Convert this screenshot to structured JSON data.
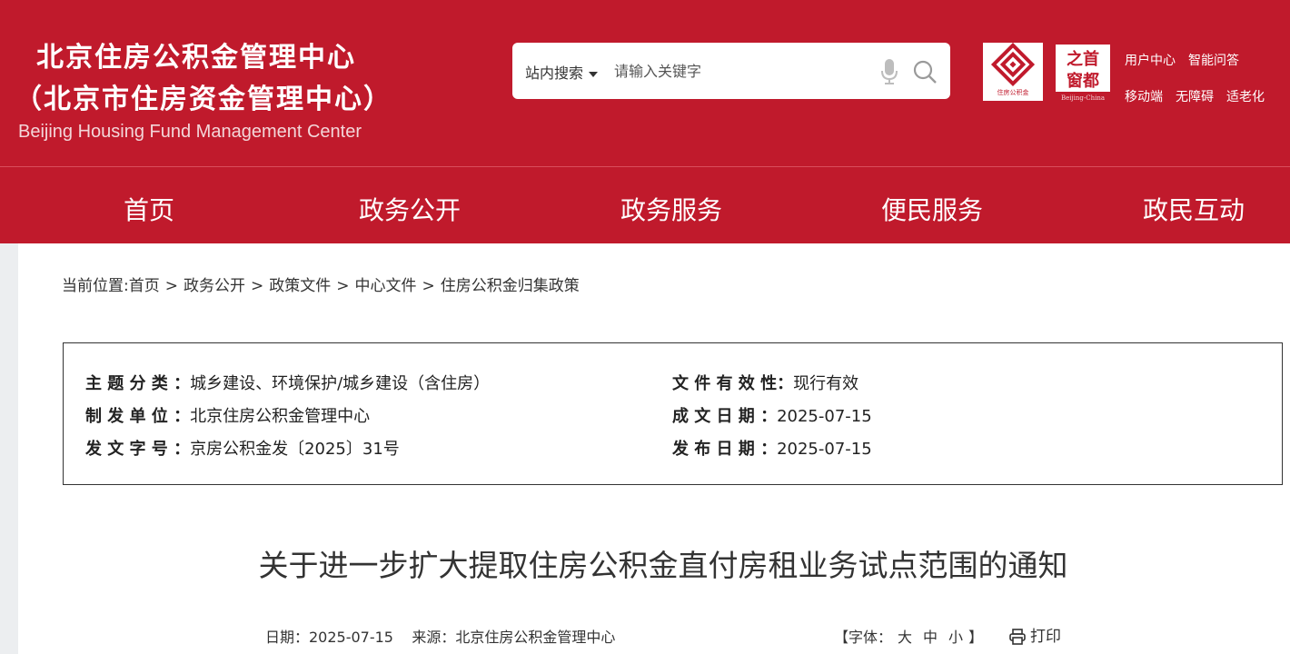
{
  "header": {
    "title_line1": "北京住房公积金管理中心",
    "title_line2": "（北京市住房资金管理中心）",
    "title_en": "Beijing Housing Fund Management Center",
    "badge_text": "住房公积金",
    "capital_text_1": "之首",
    "capital_text_2": "窗都",
    "capital_en": "Beijing-China"
  },
  "search": {
    "scope_label": "站内搜索",
    "placeholder": "请输入关键字"
  },
  "top_links": {
    "row1": [
      "用户中心",
      "智能问答"
    ],
    "row2": [
      "移动端",
      "无障碍",
      "适老化"
    ]
  },
  "nav": {
    "items": [
      "首页",
      "政务公开",
      "政务服务",
      "便民服务",
      "政民互动"
    ]
  },
  "breadcrumb": {
    "prefix": "当前位置:",
    "items": [
      "首页",
      "政务公开",
      "政策文件",
      "中心文件",
      "住房公积金归集政策"
    ]
  },
  "meta": {
    "topic_label": "主 题 分 类 ：",
    "topic_value": "城乡建设、环境保护/城乡建设（含住房）",
    "issuer_label": "制 发 单 位 ：",
    "issuer_value": "北京住房公积金管理中心",
    "doc_no_label": "发 文 字 号 ：",
    "doc_no_value": "京房公积金发〔2025〕31号",
    "validity_label": "文 件 有 效 性：",
    "validity_value": "现行有效",
    "written_label": "成 文 日 期 ：",
    "written_value": "2025-07-15",
    "published_label": "发 布 日 期 ：",
    "published_value": "2025-07-15"
  },
  "article": {
    "title": "关于进一步扩大提取住房公积金直付房租业务试点范围的通知",
    "info": "日期：2025-07-15    来源：北京住房公积金管理中心",
    "font_prefix": "【字体：",
    "font_large": "大",
    "font_medium": "中",
    "font_small": "小",
    "font_suffix": "】",
    "print_label": "打印"
  },
  "colors": {
    "brand_red": "#c01a2c",
    "gutter_gray": "#eceef0"
  }
}
